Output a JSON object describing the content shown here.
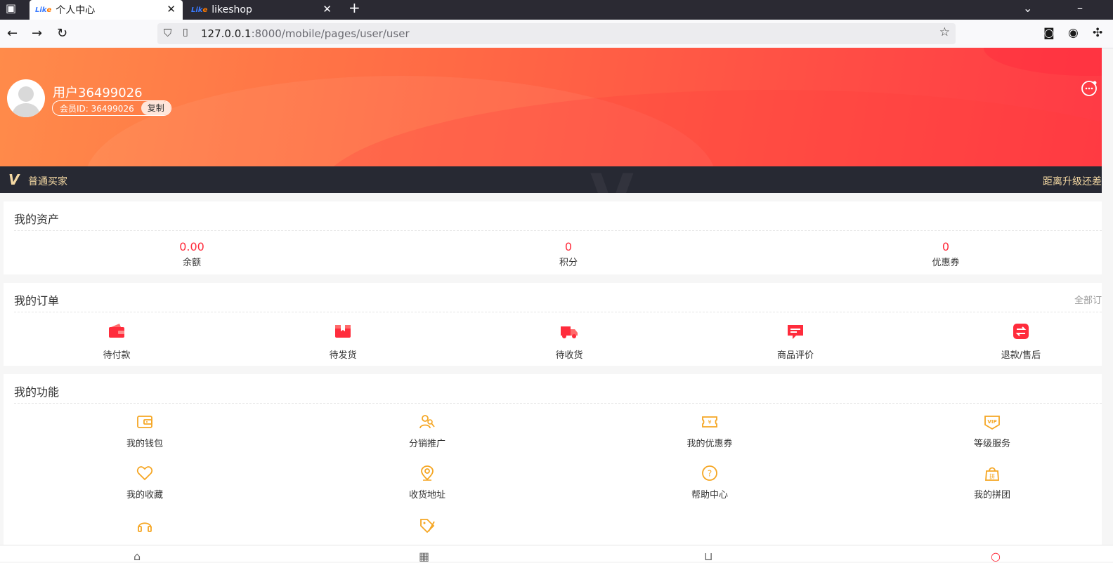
{
  "browser": {
    "tabs": [
      {
        "label": "个人中心",
        "favicon_text": "Lik",
        "favicon_accent": "e"
      },
      {
        "label": "likeshop",
        "favicon_text": "Lik",
        "favicon_accent": "e"
      }
    ],
    "url_host": "127.0.0.1",
    "url_rest": ":8000/mobile/pages/user/user"
  },
  "profile": {
    "username": "用户36499026",
    "member_id": "会员ID: 36499026",
    "copy_label": "复制"
  },
  "vip": {
    "logo": "V",
    "level": "普通买家",
    "upgrade": "距离升级还差"
  },
  "assets": {
    "title": "我的资产",
    "items": [
      {
        "value": "0.00",
        "label": "余额"
      },
      {
        "value": "0",
        "label": "积分"
      },
      {
        "value": "0",
        "label": "优惠券"
      }
    ]
  },
  "orders": {
    "title": "我的订单",
    "more": "全部订",
    "items": [
      {
        "label": "待付款",
        "icon": "wallet-icon"
      },
      {
        "label": "待发货",
        "icon": "box-icon"
      },
      {
        "label": "待收货",
        "icon": "truck-icon"
      },
      {
        "label": "商品评价",
        "icon": "comment-icon"
      },
      {
        "label": "退款/售后",
        "icon": "refund-icon"
      }
    ]
  },
  "functions": {
    "title": "我的功能",
    "items": [
      {
        "label": "我的钱包",
        "icon": "wallet-outline-icon"
      },
      {
        "label": "分销推广",
        "icon": "users-icon"
      },
      {
        "label": "我的优惠券",
        "icon": "coupon-icon"
      },
      {
        "label": "等级服务",
        "icon": "vip-icon"
      },
      {
        "label": "我的收藏",
        "icon": "heart-icon"
      },
      {
        "label": "收货地址",
        "icon": "location-icon"
      },
      {
        "label": "帮助中心",
        "icon": "help-icon"
      },
      {
        "label": "我的拼团",
        "icon": "group-buy-icon"
      },
      {
        "label": "",
        "icon": "headset-icon"
      },
      {
        "label": "",
        "icon": "tag-icon"
      }
    ]
  },
  "colors": {
    "accent_red": "#ff2c3c",
    "func_icon": "#f5a623",
    "vip_gold": "#f5d9a3",
    "vip_bar": "#272933"
  }
}
